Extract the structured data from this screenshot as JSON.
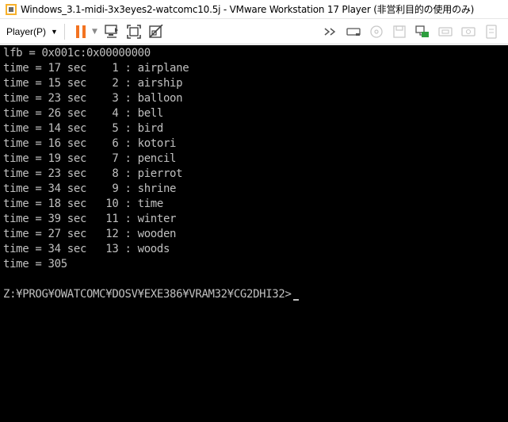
{
  "window": {
    "title": "Windows_3.1-midi-3x3eyes2-watcomc10.5j - VMware Workstation 17 Player (非営利目的の使用のみ)"
  },
  "toolbar": {
    "player_label": "Player(P)",
    "icons": [
      "pause-icon",
      "send-ctrl-alt-del-icon",
      "fit-window-icon",
      "unity-icon",
      "forward-icon",
      "hard-disk-icon",
      "cd-icon",
      "floppy-icon",
      "network-icon",
      "usb-icon",
      "sound-icon",
      "printer-icon"
    ]
  },
  "console": {
    "lines": [
      "lfb = 0x001c:0x00000000",
      "time = 17 sec    1 : airplane",
      "time = 15 sec    2 : airship",
      "time = 23 sec    3 : balloon",
      "time = 26 sec    4 : bell",
      "time = 14 sec    5 : bird",
      "time = 16 sec    6 : kotori",
      "time = 19 sec    7 : pencil",
      "time = 23 sec    8 : pierrot",
      "time = 34 sec    9 : shrine",
      "time = 18 sec   10 : time",
      "time = 39 sec   11 : winter",
      "time = 27 sec   12 : wooden",
      "time = 34 sec   13 : woods",
      "time = 305"
    ],
    "prompt": "Z:¥PROG¥OWATCOMC¥DOSV¥EXE386¥VRAM32¥CG2DHI32>"
  },
  "colors": {
    "console_bg": "#000000",
    "console_fg": "#c0c0c0",
    "pause_orange": "#f37321"
  }
}
